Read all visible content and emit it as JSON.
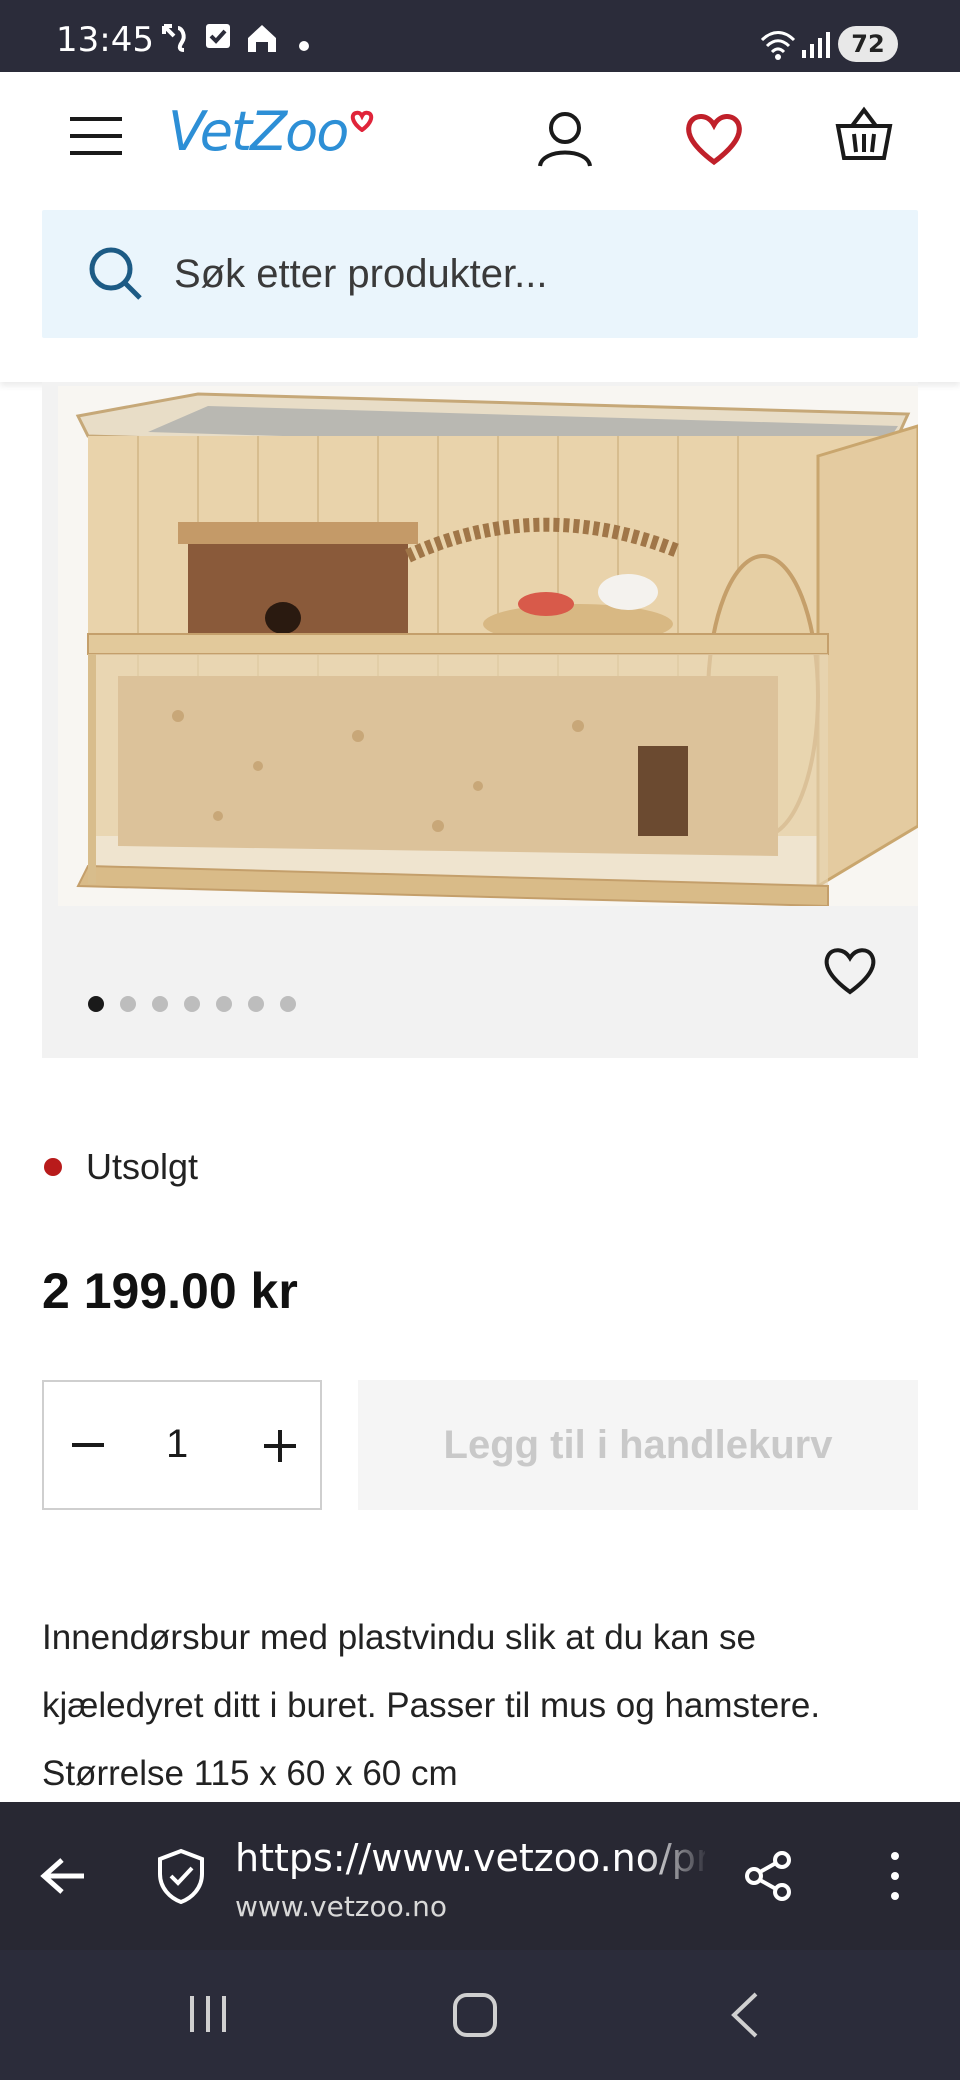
{
  "status_bar": {
    "time": "13:45",
    "battery": "72",
    "icons": [
      "missed-call-icon",
      "checkbox-icon",
      "home-icon",
      "dot-icon",
      "wifi-icon",
      "signal-icon"
    ]
  },
  "header": {
    "logo_text": "VetZoo",
    "icons": [
      "menu-icon",
      "user-icon",
      "heart-icon",
      "basket-icon"
    ],
    "search_placeholder": "Søk etter produkter..."
  },
  "gallery": {
    "image_alt": "wooden-rodent-cage-photo",
    "dot_count": 7,
    "active_dot": 0
  },
  "product": {
    "stock_status": "Utsolgt",
    "price": "2 199.00 kr",
    "quantity": "1",
    "add_to_cart_label": "Legg til i handlekurv",
    "description_lines": [
      "Innendørsbur med plastvindu slik at du kan se",
      "kjæledyret ditt i buret. Passer til mus og hamstere.",
      "Størrelse 115 x 60 x 60 cm"
    ]
  },
  "browser": {
    "url": "https://www.vetzoo.no/pr",
    "domain": "www.vetzoo.no"
  },
  "colors": {
    "brand_blue": "#2d8fd6",
    "heart_red": "#c0202a",
    "search_bg": "#eaf5fc",
    "stock_red": "#b81b1b",
    "browser_bar": "#282833"
  }
}
